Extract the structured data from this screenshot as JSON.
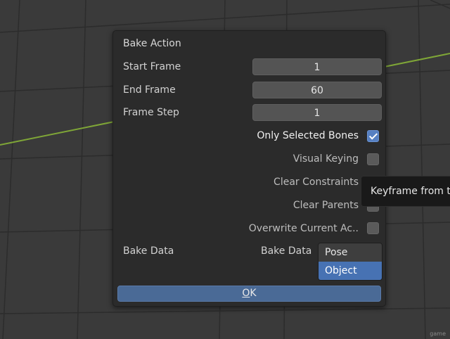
{
  "dialog": {
    "title": "Bake Action",
    "start_frame": {
      "label": "Start Frame",
      "value": "1"
    },
    "end_frame": {
      "label": "End Frame",
      "value": "60"
    },
    "frame_step": {
      "label": "Frame Step",
      "value": "1"
    },
    "options": [
      {
        "label": "Only Selected Bones",
        "checked": true
      },
      {
        "label": "Visual Keying",
        "checked": false
      },
      {
        "label": "Clear Constraints",
        "checked": false
      },
      {
        "label": "Clear Parents",
        "checked": false
      },
      {
        "label": "Overwrite Current Ac..",
        "checked": false
      }
    ],
    "bake_data": {
      "section_label": "Bake Data",
      "field_label": "Bake Data",
      "options": [
        "Pose",
        "Object"
      ],
      "selected": "Object"
    },
    "ok": {
      "mnemonic": "O",
      "rest": "K"
    }
  },
  "tooltip": {
    "text": "Keyframe from th"
  },
  "watermark": "game",
  "colors": {
    "accent": "#4772b3",
    "checkbox_on": "#5680c2",
    "ok_button": "#4a6a96",
    "axis_line": "#7fa637"
  }
}
